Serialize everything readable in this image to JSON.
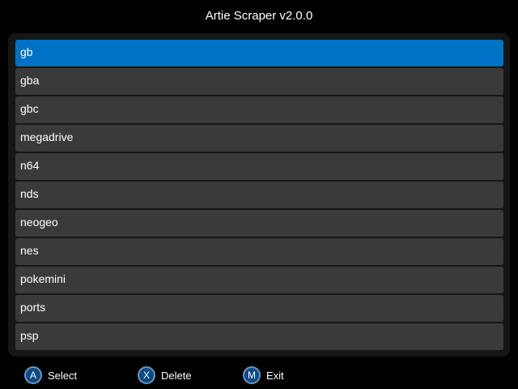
{
  "app": {
    "title": "Artie Scraper v2.0.0"
  },
  "systems": [
    {
      "label": "gb",
      "selected": true
    },
    {
      "label": "gba",
      "selected": false
    },
    {
      "label": "gbc",
      "selected": false
    },
    {
      "label": "megadrive",
      "selected": false
    },
    {
      "label": "n64",
      "selected": false
    },
    {
      "label": "nds",
      "selected": false
    },
    {
      "label": "neogeo",
      "selected": false
    },
    {
      "label": "nes",
      "selected": false
    },
    {
      "label": "pokemini",
      "selected": false
    },
    {
      "label": "ports",
      "selected": false
    },
    {
      "label": "psp",
      "selected": false
    }
  ],
  "footer": {
    "hints": [
      {
        "key": "A",
        "label": "Select",
        "icon": "a-button-icon"
      },
      {
        "key": "X",
        "label": "Delete",
        "icon": "x-button-icon"
      },
      {
        "key": "M",
        "label": "Exit",
        "icon": "m-button-icon"
      }
    ]
  },
  "colors": {
    "background": "#000000",
    "panel": "#161616",
    "item": "#3a3a3a",
    "selected": "#0072c5",
    "button": "#0b4a86"
  }
}
